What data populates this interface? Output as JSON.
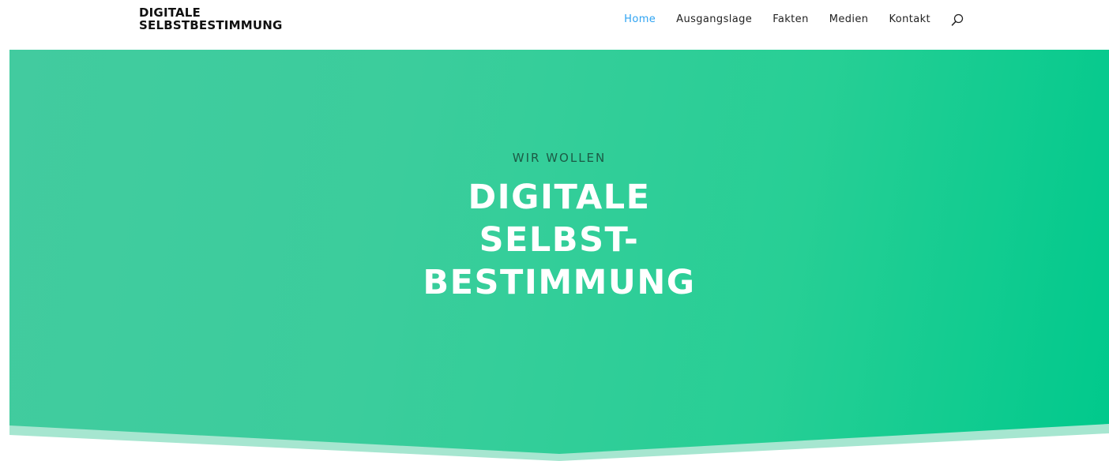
{
  "header": {
    "logo_line1": "DIGITALE",
    "logo_line2": "SELBSTBESTIMMUNG",
    "nav": [
      {
        "label": "Home",
        "active": true
      },
      {
        "label": "Ausgangslage",
        "active": false
      },
      {
        "label": "Fakten",
        "active": false
      },
      {
        "label": "Medien",
        "active": false
      },
      {
        "label": "Kontakt",
        "active": false
      }
    ],
    "search_icon": "search-icon"
  },
  "hero": {
    "subtitle": "WIR WOLLEN",
    "headline_line1": "DIGITALE",
    "headline_line2": "SELBST-",
    "headline_line3": "BESTIMMUNG"
  },
  "colors": {
    "accent": "#2ea3f2",
    "hero_start": "#42cb9f",
    "hero_end": "#00c98c",
    "divider_light": "#a6e6d0",
    "background": "#ffffff"
  }
}
